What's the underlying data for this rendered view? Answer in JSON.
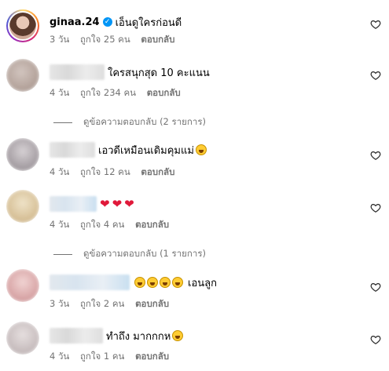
{
  "comments": [
    {
      "username": "ginaa.24",
      "verified": true,
      "text": "เอ็นดูใครก่อนดี",
      "time": "3 วัน",
      "likes": "ถูกใจ 25 คน",
      "reply": "ตอบกลับ",
      "name_blur_color": "none",
      "avatar_colors": [
        "#e8c8b6",
        "#5a3a2c"
      ]
    },
    {
      "username": "",
      "text": "ใครสนุกสุด 10 คะแนน",
      "time": "4 วัน",
      "likes": "ถูกใจ 234 คน",
      "reply": "ตอบกลับ",
      "avatar_colors": [
        "#b5a49c",
        "#d2c5bf"
      ]
    },
    {
      "username": "",
      "text": "เอวดีเหมือนเดิมคุมแม่",
      "time": "4 วัน",
      "likes": "ถูกใจ 12 คน",
      "reply": "ตอบกลับ",
      "avatar_colors": [
        "#a8a1a6",
        "#d6d1d4"
      ]
    },
    {
      "username": "",
      "text": "",
      "time": "4 วัน",
      "likes": "ถูกใจ 4 คน",
      "reply": "ตอบกลับ",
      "avatar_colors": [
        "#d8c29a",
        "#efe3c8"
      ]
    },
    {
      "username": "",
      "text": "เอนลูก",
      "time": "3 วัน",
      "likes": "ถูกใจ 2 คน",
      "reply": "ตอบกลับ",
      "avatar_colors": [
        "#d9a7a8",
        "#f1d4d3"
      ]
    },
    {
      "username": "",
      "text": "ทำถึง มากกกห",
      "time": "4 วัน",
      "likes": "ถูกใจ 1 คน",
      "reply": "ตอบกลับ",
      "avatar_colors": [
        "#c9bfc0",
        "#e6dfdf"
      ]
    }
  ],
  "view_replies": [
    "ดูข้อความตอบกลับ (2 รายการ)",
    "ดูข้อความตอบกลับ (1 รายการ)"
  ],
  "icons": {
    "like": "heart-outline-icon",
    "verified": "verified-badge-icon"
  },
  "colors": {
    "meta_text": "#737373",
    "verified_blue": "#0095f6",
    "heart_red": "#e0193a"
  }
}
